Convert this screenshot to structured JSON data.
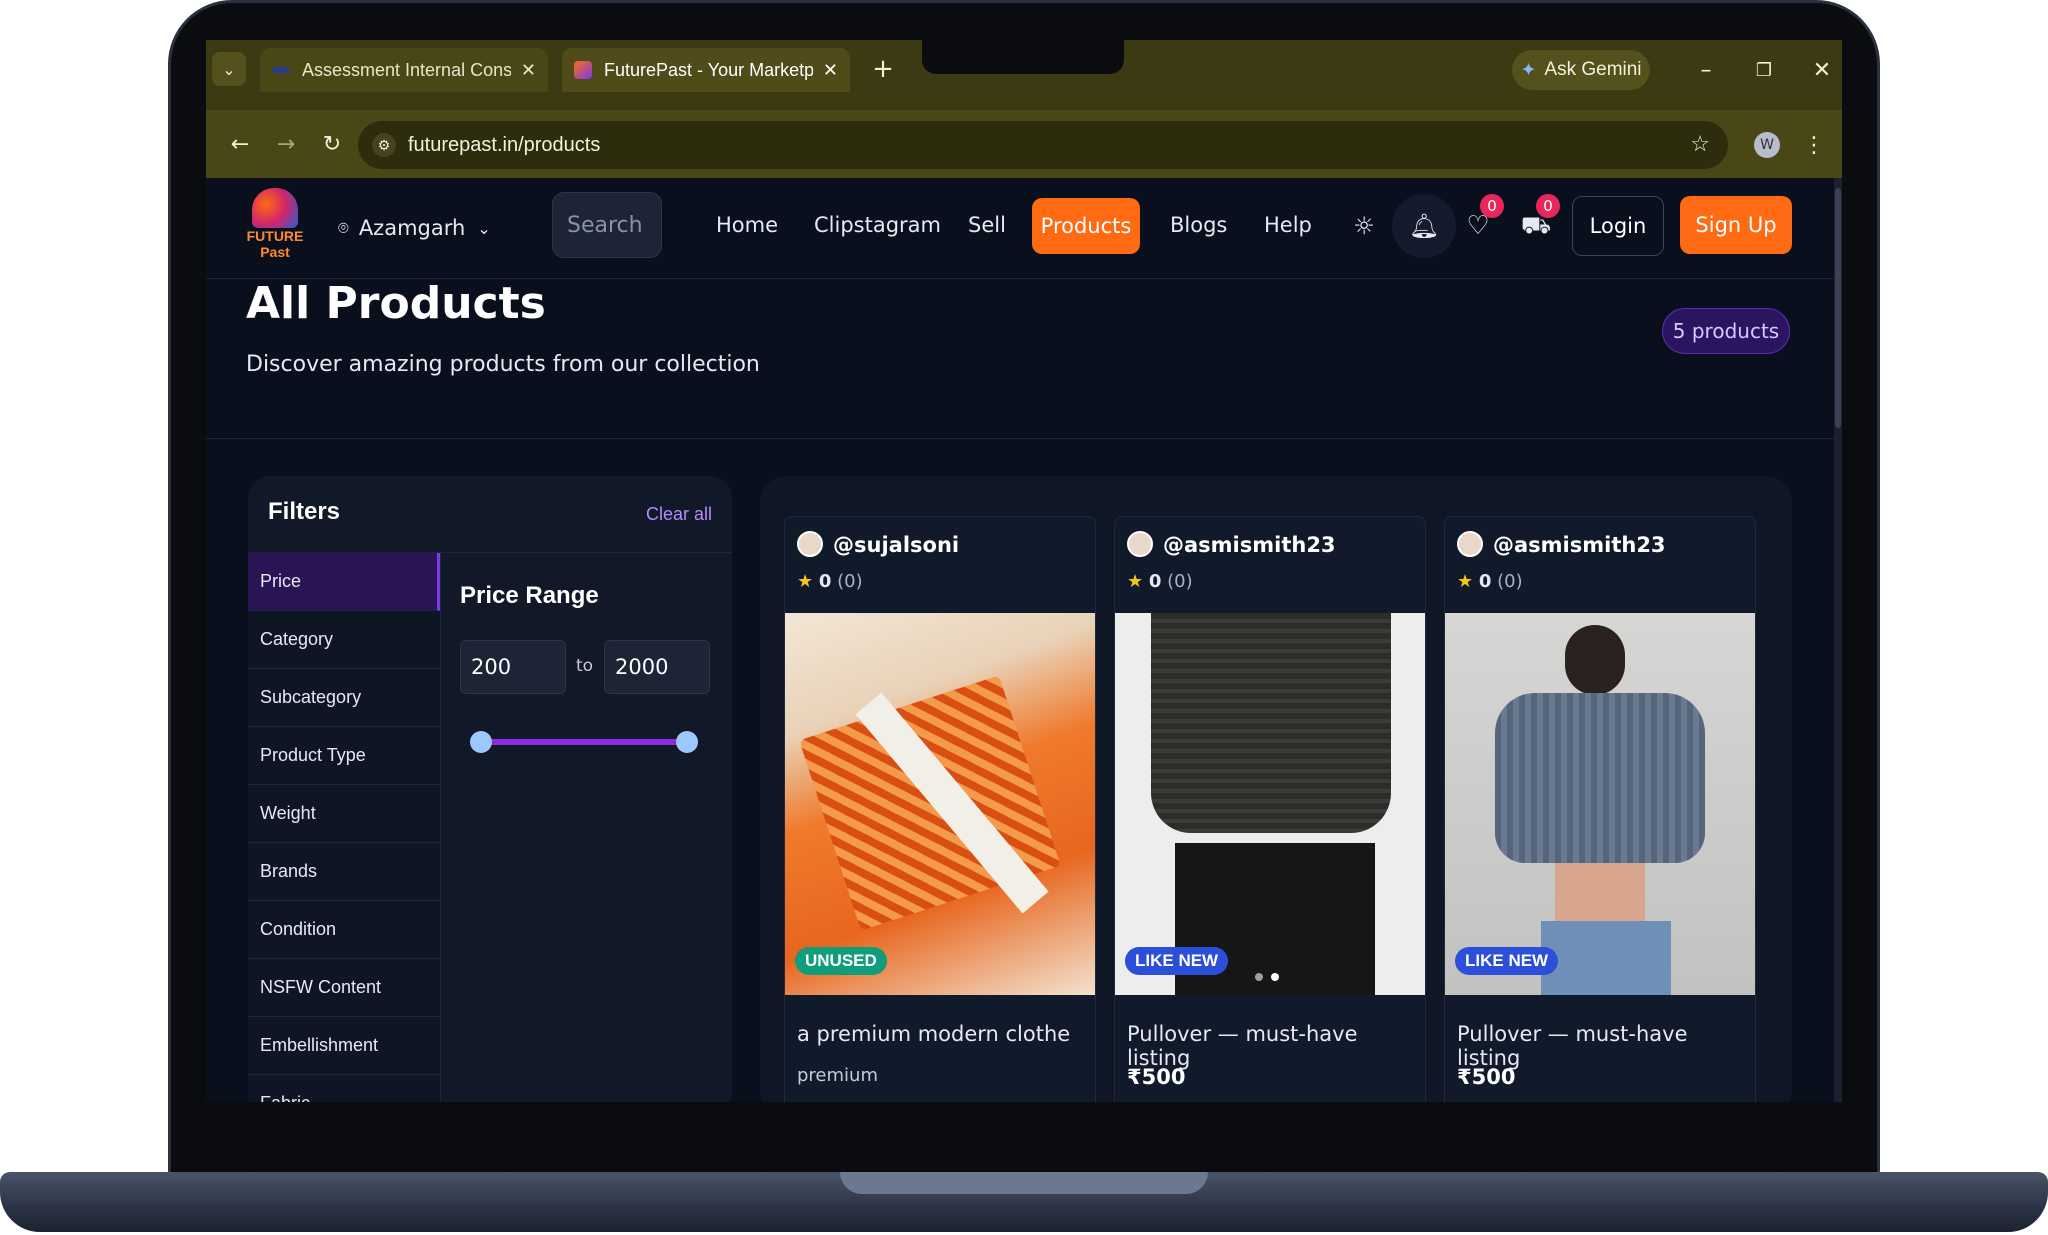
{
  "browser": {
    "tabs": [
      {
        "label": "Assessment Internal Console",
        "close": "✕"
      },
      {
        "label": "FuturePast - Your Marketplace I",
        "close": "✕"
      }
    ],
    "new_tab": "+",
    "gemini_label": "Ask Gemini",
    "url": "futurepast.in/products",
    "profile_initial": "W"
  },
  "nav": {
    "logo_text": "FUTURE Past",
    "location": "Azamgarh",
    "search_placeholder": "Search",
    "links": [
      "Home",
      "Clipstagram",
      "Sell",
      "Products",
      "Blogs",
      "Help"
    ],
    "wishlist_count": "0",
    "cart_count": "0",
    "login_label": "Login",
    "signup_label": "Sign Up"
  },
  "header": {
    "title": "All Products",
    "subtitle": "Discover amazing products from our collection",
    "count_badge": "5 products"
  },
  "filters": {
    "title": "Filters",
    "clear_label": "Clear all",
    "items": [
      "Price",
      "Category",
      "Subcategory",
      "Product Type",
      "Weight",
      "Brands",
      "Condition",
      "NSFW Content",
      "Embellishment",
      "Fabric"
    ],
    "active": "Price",
    "price_range": {
      "label": "Price Range",
      "min": "200",
      "max": "2000",
      "separator": "to",
      "slider_min_fraction": 0,
      "slider_max_fraction": 1
    }
  },
  "products": [
    {
      "user": "@sujalsoni",
      "rating": "0",
      "reviews": "(0)",
      "condition": "UNUSED",
      "condition_color": "#0f9d7a",
      "title": "a premium modern clothe",
      "subtitle": "premium"
    },
    {
      "user": "@asmismith23",
      "rating": "0",
      "reviews": "(0)",
      "condition": "LIKE NEW",
      "condition_color": "#2b4fd8",
      "title": "Pullover — must-have listing",
      "subtitle": "₹500"
    },
    {
      "user": "@asmismith23",
      "rating": "0",
      "reviews": "(0)",
      "condition": "LIKE NEW",
      "condition_color": "#2b4fd8",
      "title": "Pullover — must-have listing",
      "subtitle": "₹500"
    }
  ],
  "colors": {
    "accent": "#ff6a13",
    "purple": "#7c3aed",
    "page_bg": "#0a0f1e"
  }
}
